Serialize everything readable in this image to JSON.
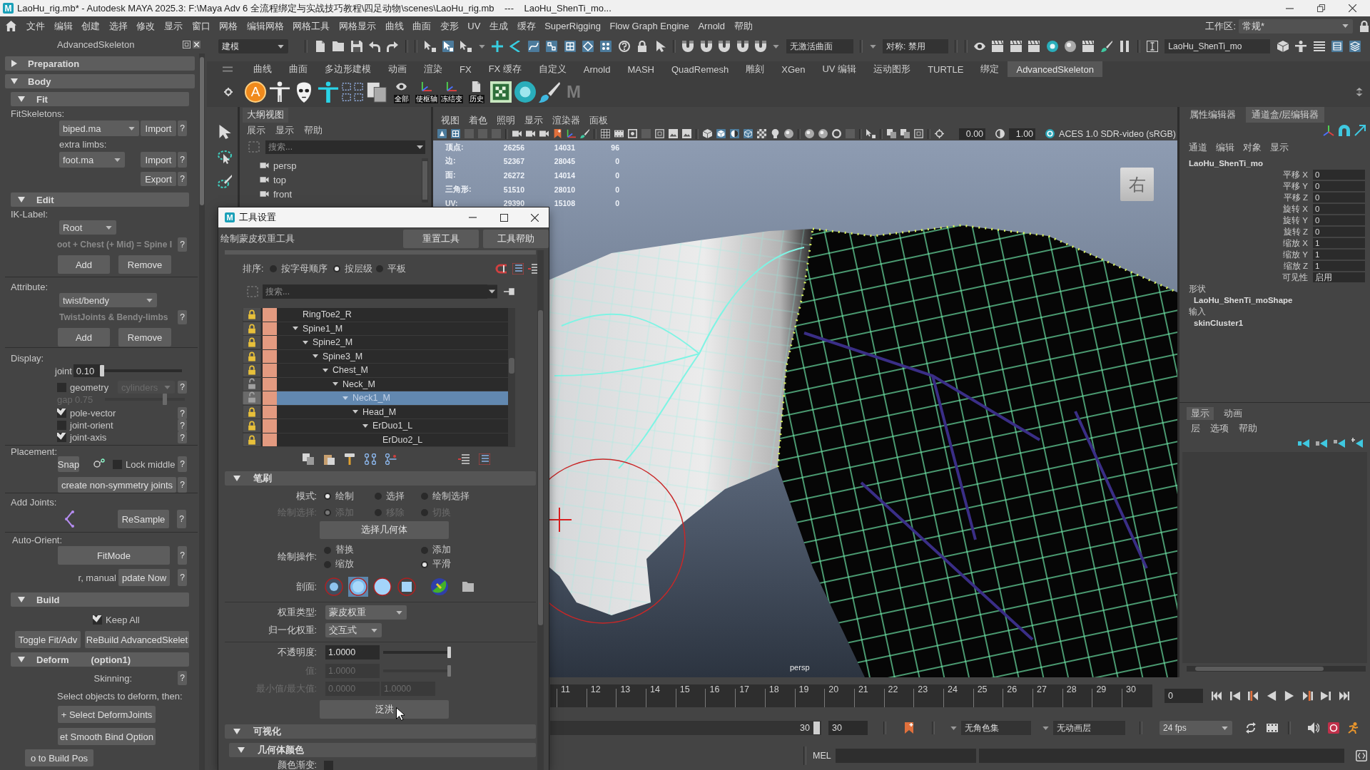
{
  "window": {
    "icon_letter": "M",
    "title": "LaoHu_rig.mb* - Autodesk MAYA 2025.3: F:\\Maya Adv 6 全流程绑定与实战技巧教程\\四足动物\\scenes\\LaoHu_rig.mb    ---    LaoHu_ShenTi_mo..."
  },
  "menu_bar": {
    "items": [
      "文件",
      "编辑",
      "创建",
      "选择",
      "修改",
      "显示",
      "窗口",
      "网格",
      "编辑网格",
      "网格工具",
      "网格显示",
      "曲线",
      "曲面",
      "变形",
      "UV",
      "生成",
      "缓存",
      "SuperRigging",
      "Flow Graph Engine",
      "Arnold",
      "帮助"
    ],
    "workspace_label": "工作区:",
    "workspace": "常规*"
  },
  "status_line": {
    "mode": "建模",
    "live_surface": "无激活曲面",
    "symmetry": "对称: 禁用",
    "object_name": "LaoHu_ShenTi_mo"
  },
  "shelf": {
    "tabs": [
      {
        "label": "曲线",
        "selected": false
      },
      {
        "label": "曲面",
        "selected": false
      },
      {
        "label": "多边形建模",
        "selected": false
      },
      {
        "label": "动画",
        "selected": false
      },
      {
        "label": "渲染",
        "selected": false
      },
      {
        "label": "FX",
        "selected": false
      },
      {
        "label": "FX 缓存",
        "selected": false
      },
      {
        "label": "自定义",
        "selected": false
      },
      {
        "label": "Arnold",
        "selected": false
      },
      {
        "label": "MASH",
        "selected": false
      },
      {
        "label": "QuadRemesh",
        "selected": false
      },
      {
        "label": "雕刻",
        "selected": false
      },
      {
        "label": "XGen",
        "selected": false
      },
      {
        "label": "UV 编辑",
        "selected": false
      },
      {
        "label": "运动图形",
        "selected": false
      },
      {
        "label": "TURTLE",
        "selected": false
      },
      {
        "label": "绑定",
        "selected": false
      },
      {
        "label": "AdvancedSkeleton",
        "selected": true
      }
    ],
    "first_button": "A",
    "buttons": [
      "全部",
      "使枢轴",
      "冻结变",
      "历史"
    ],
    "last_button": "M"
  },
  "advanced_skeleton": {
    "title": "AdvancedSkeleton",
    "preparation": {
      "title": "Preparation",
      "expanded": false
    },
    "body": {
      "title": "Body",
      "expanded": true
    },
    "fit": {
      "title": "Fit",
      "expanded": true
    },
    "fit_skeletons": {
      "label": "FitSkeletons:",
      "value": "biped.ma",
      "button": "Import",
      "help": "?"
    },
    "extra_limbs": {
      "label": "extra limbs:",
      "value": "foot.ma",
      "button": "Import",
      "help": "?"
    },
    "export": {
      "button": "Export",
      "help": "?"
    },
    "edit": {
      "title": "Edit",
      "expanded": true
    },
    "ik_label": {
      "label": "IK-Label:",
      "value": "Root",
      "hint": "oot + Chest (+ Mid) = Spine I",
      "help": "?",
      "buttons": [
        "Add",
        "Remove"
      ]
    },
    "attribute": {
      "label": "Attribute:",
      "value": "twist/bendy",
      "hint": "TwistJoints & Bendy-limbs",
      "help": "?",
      "buttons": [
        "Add",
        "Remove"
      ]
    },
    "display": {
      "label": "Display:",
      "joint": {
        "label": "joint",
        "value": "0.10",
        "level": 0
      },
      "geometry": {
        "label": "geometry",
        "checked": false,
        "value": "cylinders",
        "help": "?"
      },
      "gap": {
        "label": "gap",
        "value": "0.75",
        "level": 0.75
      },
      "options": [
        {
          "label": "pole-vector",
          "checked": true,
          "help": "?"
        },
        {
          "label": "joint-orient",
          "checked": false,
          "help": "?"
        },
        {
          "label": "joint-axis",
          "checked": true,
          "help": "?"
        }
      ]
    },
    "placement": {
      "label": "Placement:",
      "snap": "Snap",
      "lock_middle": {
        "label": "Lock middle",
        "checked": false
      },
      "help": "?",
      "create": "create non-symmetry joints",
      "create_help": "?"
    },
    "add_joints": {
      "label": "Add Joints:",
      "button": "ReSample",
      "help": "?"
    },
    "auto_orient": {
      "label": "Auto-Orient:",
      "button": "FitMode",
      "help": "?",
      "manual_label": "r, manual",
      "manual_button": "pdate Now",
      "manual_help": "?"
    },
    "build": {
      "title": "Build",
      "expanded": true,
      "keep_all": {
        "label": "Keep All",
        "checked": true
      },
      "buttons": [
        "Toggle Fit/Adv",
        "ReBuild AdvancedSkelet"
      ]
    },
    "deform": {
      "title": "Deform",
      "option": "(option1)",
      "expanded": true,
      "skinning": "Skinning:",
      "help": "?",
      "hint": "Select objects to deform, then:",
      "buttons": [
        "+ Select DeformJoints",
        "et Smooth Bind Option",
        "o to Build Pos"
      ]
    }
  },
  "outliner": {
    "tab": "大纲视图",
    "menu": [
      "展示",
      "显示",
      "帮助"
    ],
    "search": {
      "placeholder": "搜索..."
    },
    "items": [
      "persp",
      "top",
      "front"
    ]
  },
  "viewport": {
    "menu": [
      "视图",
      "着色",
      "照明",
      "显示",
      "渲染器",
      "面板"
    ],
    "exposure": "0.00",
    "gamma": "1.00",
    "color_space": "ACES 1.0 SDR-video (sRGB)",
    "stats": [
      {
        "label": "顶点:",
        "values": [
          "26256",
          "14031",
          "96"
        ]
      },
      {
        "label": "边:",
        "values": [
          "52367",
          "28045",
          "0"
        ]
      },
      {
        "label": "面:",
        "values": [
          "26272",
          "14014",
          "0"
        ]
      },
      {
        "label": "三角形:",
        "values": [
          "51510",
          "28010",
          "0"
        ]
      },
      {
        "label": "UV:",
        "values": [
          "29390",
          "15108",
          "0"
        ]
      }
    ],
    "view_cube": "右",
    "camera": "persp"
  },
  "channel_box": {
    "tabs": [
      {
        "label": "属性编辑器",
        "selected": false
      },
      {
        "label": "通道盒/层编辑器",
        "selected": true
      }
    ],
    "menu": [
      "通道",
      "编辑",
      "对象",
      "显示"
    ],
    "object": "LaoHu_ShenTi_mo",
    "channels": [
      {
        "label": "平移 X",
        "value": "0"
      },
      {
        "label": "平移 Y",
        "value": "0"
      },
      {
        "label": "平移 Z",
        "value": "0"
      },
      {
        "label": "旋转 X",
        "value": "0"
      },
      {
        "label": "旋转 Y",
        "value": "0"
      },
      {
        "label": "旋转 Z",
        "value": "0"
      },
      {
        "label": "缩放 X",
        "value": "1"
      },
      {
        "label": "缩放 Y",
        "value": "1"
      },
      {
        "label": "缩放 Z",
        "value": "1"
      },
      {
        "label": "可见性",
        "value": "启用"
      }
    ],
    "shapes_label": "形状",
    "shape": "LaoHu_ShenTi_moShape",
    "inputs_label": "输入",
    "input": "skinCluster1"
  },
  "layer_editor": {
    "tabs": [
      {
        "label": "显示",
        "selected": true
      },
      {
        "label": "动画",
        "selected": false
      }
    ],
    "menu": [
      "层",
      "选项",
      "帮助"
    ]
  },
  "tool_settings": {
    "icon_letter": "M",
    "title": "工具设置",
    "tool_name": "绘制蒙皮权重工具",
    "buttons": [
      "重置工具",
      "工具帮助"
    ],
    "sort": {
      "label": "排序:",
      "options": [
        {
          "label": "按字母顺序",
          "selected": false
        },
        {
          "label": "按层级",
          "selected": true
        },
        {
          "label": "平板",
          "selected": false
        }
      ]
    },
    "search": {
      "placeholder": "搜索..."
    },
    "influences": [
      {
        "name": "RingToe2_R",
        "locked": true,
        "selected": false,
        "expanded": false
      },
      {
        "name": "Spine1_M",
        "locked": true,
        "selected": false,
        "expanded": true,
        "children": [
          {
            "name": "Spine2_M",
            "locked": true,
            "selected": false,
            "expanded": true,
            "children": [
              {
                "name": "Spine3_M",
                "locked": true,
                "selected": false,
                "expanded": true,
                "children": [
                  {
                    "name": "Chest_M",
                    "locked": true,
                    "selected": false,
                    "expanded": true,
                    "children": [
                      {
                        "name": "Neck_M",
                        "locked": false,
                        "selected": false,
                        "expanded": true,
                        "children": [
                          {
                            "name": "Neck1_M",
                            "locked": false,
                            "selected": true,
                            "expanded": true,
                            "children": [
                              {
                                "name": "Head_M",
                                "locked": true,
                                "selected": false,
                                "expanded": true,
                                "children": [
                                  {
                                    "name": "ErDuo1_L",
                                    "locked": true,
                                    "selected": false,
                                    "expanded": true,
                                    "children": [
                                      {
                                        "name": "ErDuo2_L",
                                        "locked": true,
                                        "selected": false,
                                        "expanded": false
                                      }
                                    ]
                                  }
                                ]
                              }
                            ]
                          }
                        ]
                      }
                    ]
                  }
                ]
              }
            ]
          }
        ]
      }
    ],
    "brush": {
      "title": "笔刷",
      "expanded": true,
      "mode": {
        "label": "模式:",
        "options": [
          {
            "label": "绘制",
            "selected": true
          },
          {
            "label": "选择",
            "selected": false
          },
          {
            "label": "绘制选择",
            "selected": false
          }
        ]
      },
      "paint_select": {
        "label": "绘制选择:",
        "disabled": true,
        "options": [
          {
            "label": "添加",
            "selected": true
          },
          {
            "label": "移除",
            "selected": false
          },
          {
            "label": "切换",
            "selected": false
          }
        ]
      },
      "select_geometry": "选择几何体",
      "paint_operation": {
        "label": "绘制操作:",
        "options": [
          {
            "label": "替换",
            "selected": false
          },
          {
            "label": "添加",
            "selected": false
          },
          {
            "label": "缩放",
            "selected": false
          },
          {
            "label": "平滑",
            "selected": true
          }
        ]
      },
      "profile": {
        "label": "剖面:",
        "options": [
          {
            "selected": false
          },
          {
            "selected": true
          },
          {
            "selected": false
          },
          {
            "selected": false
          },
          {
            "selected": false
          }
        ]
      },
      "weight_type": {
        "label": "权重类型:",
        "value": "蒙皮权重"
      },
      "normalize": {
        "label": "归一化权重:",
        "value": "交互式"
      },
      "opacity": {
        "label": "不透明度:",
        "value": "1.0000",
        "level": 1
      },
      "value": {
        "label": "值:",
        "value": "1.0000",
        "level": 1,
        "disabled": true
      },
      "min_max": {
        "label": "最小值/最大值:",
        "min": "0.0000",
        "max": "1.0000",
        "disabled": true
      },
      "flood": "泛洪"
    },
    "display": {
      "title": "可视化",
      "expanded": true
    },
    "geometry_color": {
      "title": "几何体颜色",
      "expanded": true,
      "color_ramp": {
        "label": "颜色渐变:",
        "checked": false
      }
    }
  },
  "time_slider": {
    "ticks": [
      "11",
      "12",
      "13",
      "14",
      "15",
      "16",
      "17",
      "18",
      "19",
      "20",
      "21",
      "22",
      "23",
      "24",
      "25",
      "26",
      "27",
      "28",
      "29",
      "30"
    ],
    "current_frame": "0"
  },
  "range_slider": {
    "end": "30",
    "level": 1,
    "end_field": "30",
    "character_set": "无角色集",
    "anim_layer": "无动画层",
    "fps": "24 fps"
  },
  "command_line": {
    "language": "MEL"
  }
}
